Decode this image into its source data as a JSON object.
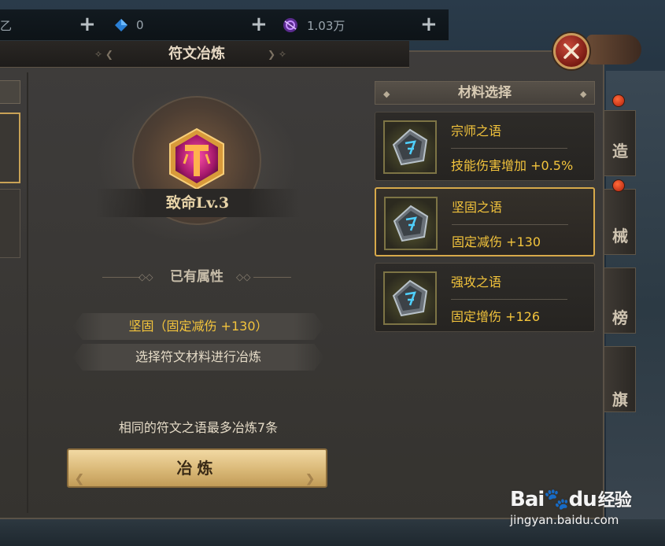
{
  "topbar": {
    "currency1_partial": "乙",
    "gem_amount": "0",
    "orb_amount": "1.03万",
    "plus": "+"
  },
  "panel": {
    "title": "符文冶炼"
  },
  "rune": {
    "level_label": "致命Lv.3"
  },
  "attributes": {
    "heading": "已有属性",
    "current": "坚固（固定减伤 +130）",
    "prompt": "选择符文材料进行冶炼"
  },
  "hint": "相同的符文之语最多冶炼7条",
  "refine_button": "冶炼",
  "materials": {
    "heading": "材料选择",
    "items": [
      {
        "name": "宗师之语",
        "effect": "技能伤害增加 +0.5%",
        "selected": false
      },
      {
        "name": "坚固之语",
        "effect": "固定减伤 +130",
        "selected": true
      },
      {
        "name": "强攻之语",
        "effect": "固定增伤 +126",
        "selected": false
      }
    ]
  },
  "side_tabs": [
    "造",
    "械",
    "榜",
    "旗"
  ],
  "watermark": {
    "logo": "Bai",
    "logo_mid": "du",
    "logo_cn": "经验",
    "url": "jingyan.baidu.com"
  },
  "colors": {
    "gold_text": "#f3c43c",
    "selected_border": "#d7a94a",
    "close_red": "#c84a3a"
  }
}
